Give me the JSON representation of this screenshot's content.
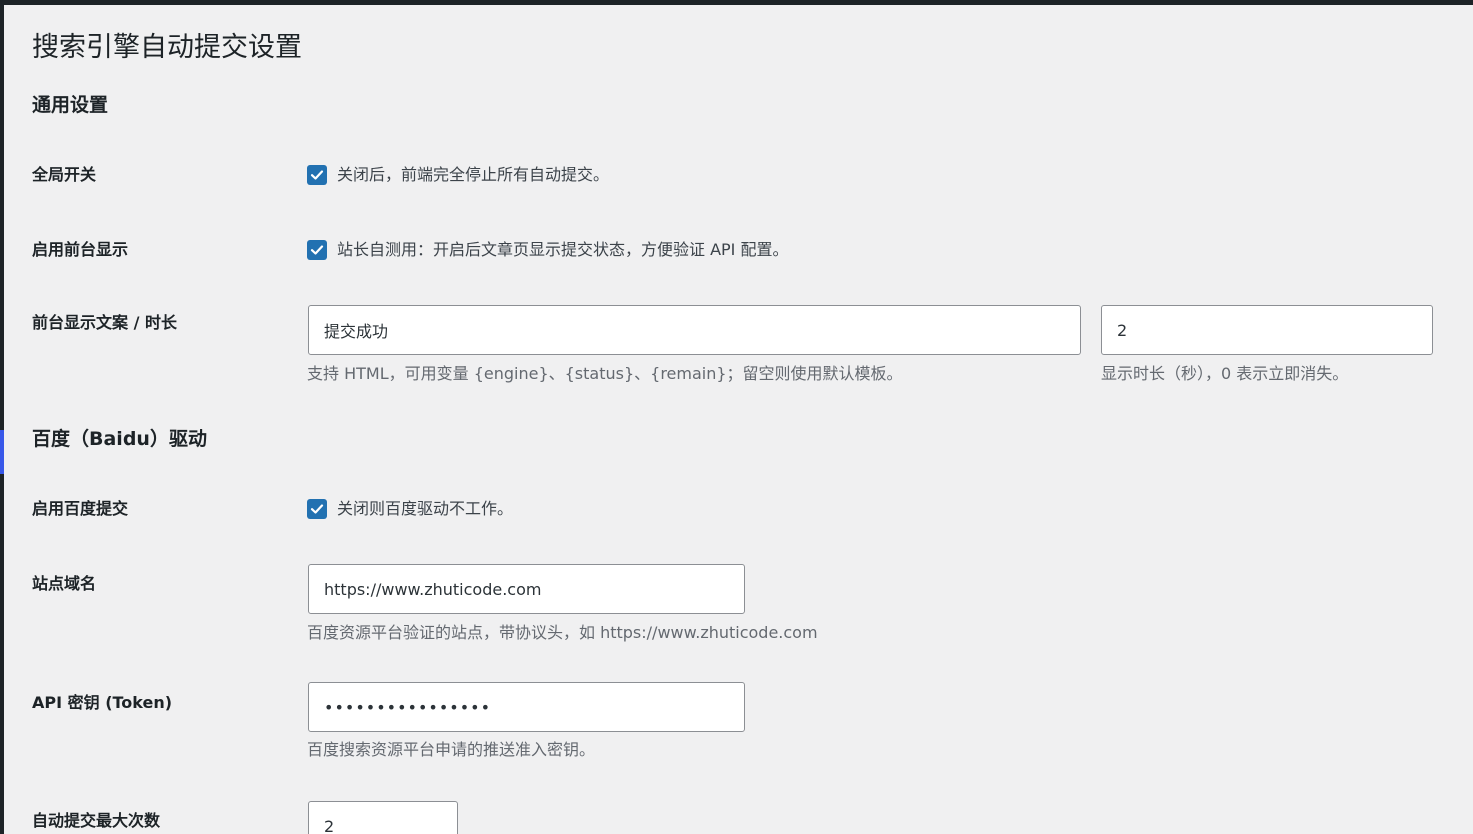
{
  "page": {
    "title": "搜索引擎自动提交设置"
  },
  "general": {
    "title": "通用设置",
    "global_switch": {
      "label": "全局开关",
      "checked": true,
      "description": "关闭后，前端完全停止所有自动提交。"
    },
    "frontend_display": {
      "label": "启用前台显示",
      "checked": true,
      "description": "站长自测用：开启后文章页显示提交状态，方便验证 API 配置。"
    },
    "display_text": {
      "label": "前台显示文案 / 时长",
      "text_value": "提交成功",
      "text_description": "支持 HTML，可用变量 {engine}、{status}、{remain}；留空则使用默认模板。",
      "duration_value": "2",
      "duration_description": "显示时长（秒），0 表示立即消失。"
    }
  },
  "baidu": {
    "title": "百度（Baidu）驱动",
    "enable": {
      "label": "启用百度提交",
      "checked": true,
      "description": "关闭则百度驱动不工作。"
    },
    "site_domain": {
      "label": "站点域名",
      "value": "https://www.zhuticode.com",
      "description": "百度资源平台验证的站点，带协议头，如 https://www.zhuticode.com"
    },
    "api_token": {
      "label": "API 密钥 (Token)",
      "value": "••••••••••••••••",
      "description": "百度搜索资源平台申请的推送准入密钥。"
    },
    "max_submits": {
      "label": "自动提交最大次数",
      "value": "2"
    }
  },
  "colors": {
    "accent": "#2271b1",
    "background": "#f0f0f1",
    "admin_bar": "#1d2327",
    "menu_highlight": "#3858e9"
  }
}
